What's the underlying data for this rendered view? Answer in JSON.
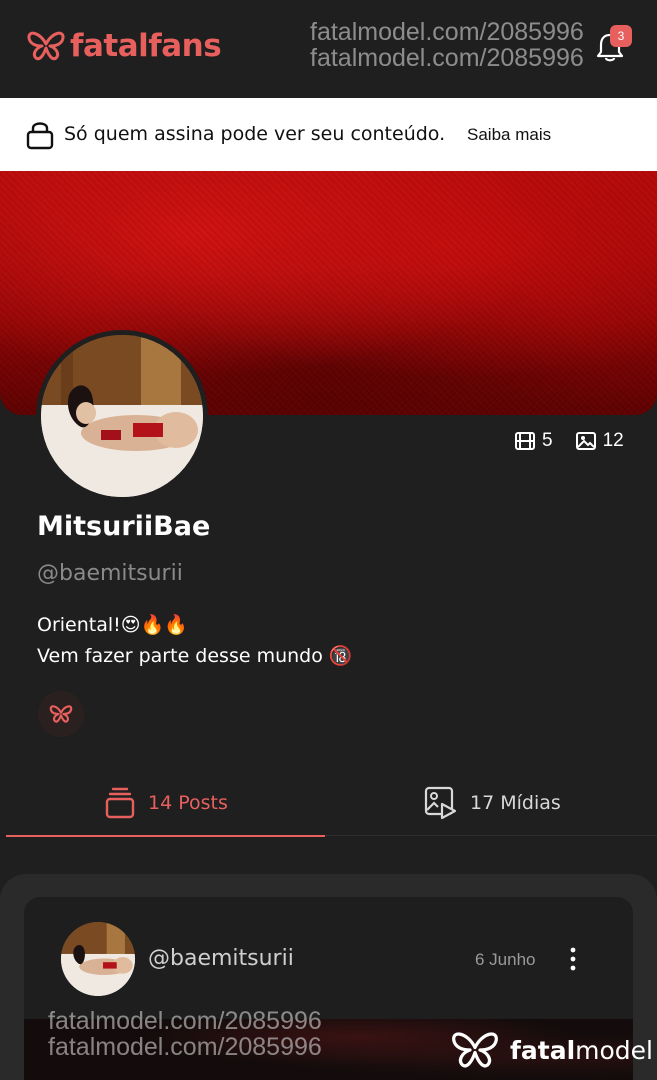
{
  "header": {
    "logo_text": "fatalfans",
    "notifications_count": "3",
    "watermark_line1": "fatalmodel.com/2085996",
    "watermark_line2": "fatalmodel.com/2085996"
  },
  "notice": {
    "text": "Só quem assina pode ver seu conteúdo.",
    "link": "Saiba mais"
  },
  "profile": {
    "video_count": "5",
    "image_count": "12",
    "name": "MitsuriiBae",
    "handle": "@baemitsurii",
    "bio_line1": "Oriental!",
    "bio_line1_emojis": "😍🔥🔥",
    "bio_line2": "Vem fazer parte desse mundo",
    "bio_line2_emoji": "🔞"
  },
  "tabs": {
    "posts": "14 Posts",
    "midias": "17 Mídias",
    "active": "posts"
  },
  "post": {
    "handle": "@baemitsurii",
    "date": "6 Junho"
  },
  "footer_watermark": {
    "line1": "fatalmodel.com/2085996",
    "line2": "fatalmodel.com/2085996",
    "brand_bold": "fatal",
    "brand_regular": "model"
  },
  "colors": {
    "accent": "#e8605e",
    "background": "#1f1f1f",
    "banner": "#b40b0b"
  }
}
